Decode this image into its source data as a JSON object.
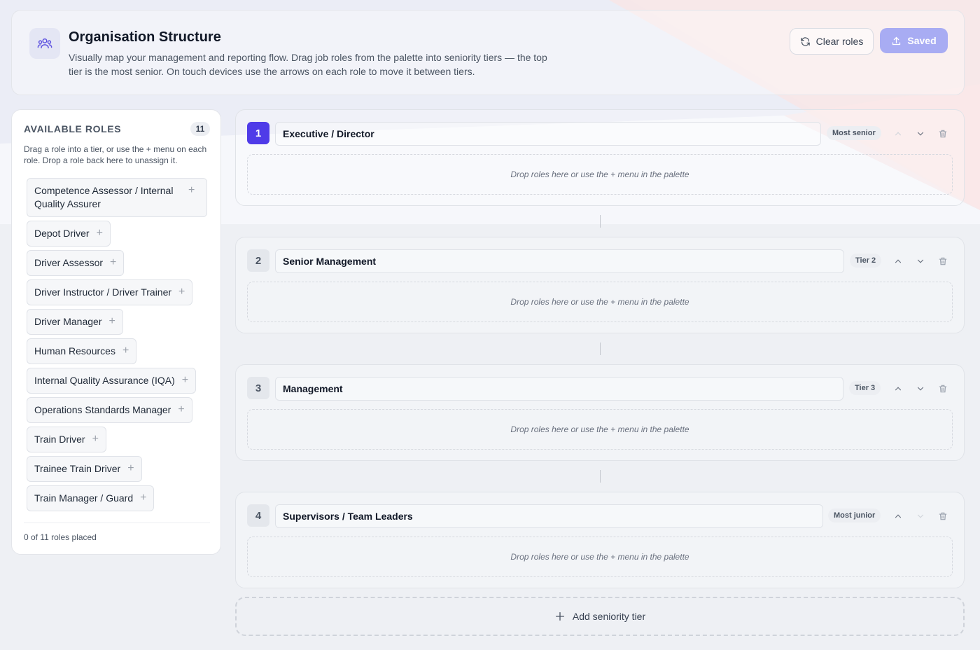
{
  "header": {
    "title": "Organisation Structure",
    "description": "Visually map your management and reporting flow. Drag job roles from the palette into seniority tiers — the top tier is the most senior. On touch devices use the arrows on each role to move it between tiers.",
    "icon": "people-icon",
    "clear_label": "Clear roles",
    "saved_label": "Saved",
    "accent_color": "#4f3be8"
  },
  "palette": {
    "title": "AVAILABLE ROLES",
    "count": "11",
    "hint": "Drag a role into a tier, or use the + menu on each role. Drop a role back here to unassign it.",
    "roles": [
      "Competence Assessor / Internal Quality Assurer",
      "Depot Driver",
      "Driver Assessor",
      "Driver Instructor / Driver Trainer",
      "Driver Manager",
      "Human Resources",
      "Internal Quality Assurance (IQA)",
      "Operations Standards Manager",
      "Train Driver",
      "Trainee Train Driver",
      "Train Manager / Guard"
    ],
    "footer": "0 of 11 roles placed"
  },
  "tiers": [
    {
      "number": "1",
      "name": "Executive / Director",
      "badge": "Most senior",
      "drop_hint": "Drop roles here or use the + menu in the palette"
    },
    {
      "number": "2",
      "name": "Senior Management",
      "badge": "Tier 2",
      "drop_hint": "Drop roles here or use the + menu in the palette"
    },
    {
      "number": "3",
      "name": "Management",
      "badge": "Tier 3",
      "drop_hint": "Drop roles here or use the + menu in the palette"
    },
    {
      "number": "4",
      "name": "Supervisors / Team Leaders",
      "badge": "Most junior",
      "drop_hint": "Drop roles here or use the + menu in the palette"
    }
  ],
  "add_tier_label": "Add seniority tier"
}
